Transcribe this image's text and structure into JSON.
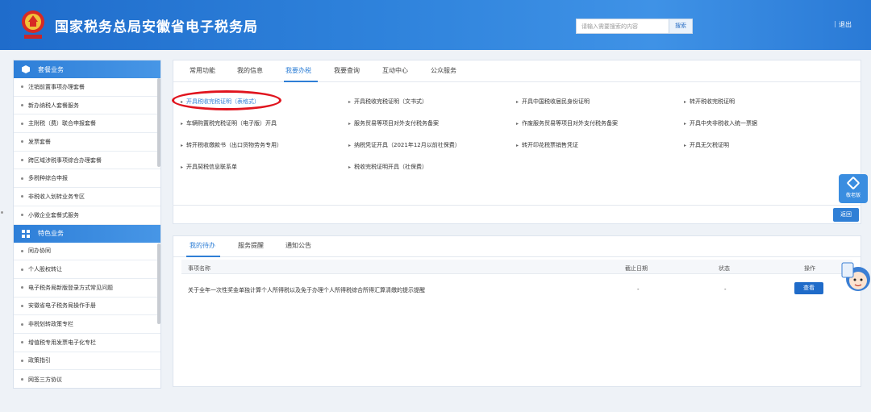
{
  "header": {
    "title": "国家税务总局安徽省电子税务局",
    "search_placeholder": "请输入需要搜索的内容",
    "search_button": "搜索",
    "separator": "|",
    "logout": "退出"
  },
  "sidebar": {
    "section1_title": "套餐业务",
    "section1_items": [
      "注销前置事项办理套餐",
      "新办纳税人套餐服务",
      "主附税（费）联合申报套餐",
      "发票套餐",
      "跨区域涉税事项综合办理套餐",
      "多税种综合申报",
      "非税收入划转业务专区",
      "小微企业套餐式服务"
    ],
    "section2_title": "特色业务",
    "section2_items": [
      "同办协同",
      "个人股权转让",
      "电子税务局新版登录方式常见问题",
      "安徽省电子税务局操作手册",
      "非税划转政策专栏",
      "增值税专用发票电子化专栏",
      "政策指引",
      "网签三方协议"
    ]
  },
  "main_tabs": [
    "常用功能",
    "我的信息",
    "我要办税",
    "我要查询",
    "互动中心",
    "公众服务"
  ],
  "links": [
    "开具税收完税证明（表格式）",
    "开具税收完税证明（文书式）",
    "开具中国税收居民身份证明",
    "转开税收完税证明",
    "车辆购置税完税证明（电子版）开具",
    "服务贸易等项目对外支付税务备案",
    "作废服务贸易等项目对外支付税务备案",
    "开具中央非税收入统一票据",
    "转开税收缴款书（出口货物劳务专用）",
    "纳税凭证开具（2021年12月以前社保费）",
    "转开印花税票销售凭证",
    "开具无欠税证明",
    "开具契税信息联系单",
    "税收完税证明开具（社保费）"
  ],
  "back_button": "返回",
  "todo_tabs": [
    "我的待办",
    "服务提醒",
    "通知公告"
  ],
  "todo_table": {
    "headers": [
      "事项名称",
      "截止日期",
      "状态",
      "操作"
    ],
    "rows": [
      {
        "name": "关于全年一次性奖金单独计算个人所得税以及免于办理个人所得税综合所得汇算清缴的提示提醒",
        "deadline": "-",
        "status": "-",
        "action": "查看"
      }
    ]
  },
  "float_widget": {
    "label": "敬老版"
  },
  "colors": {
    "brand_blue": "#2f7fd6",
    "highlight_red": "#e0141e"
  }
}
